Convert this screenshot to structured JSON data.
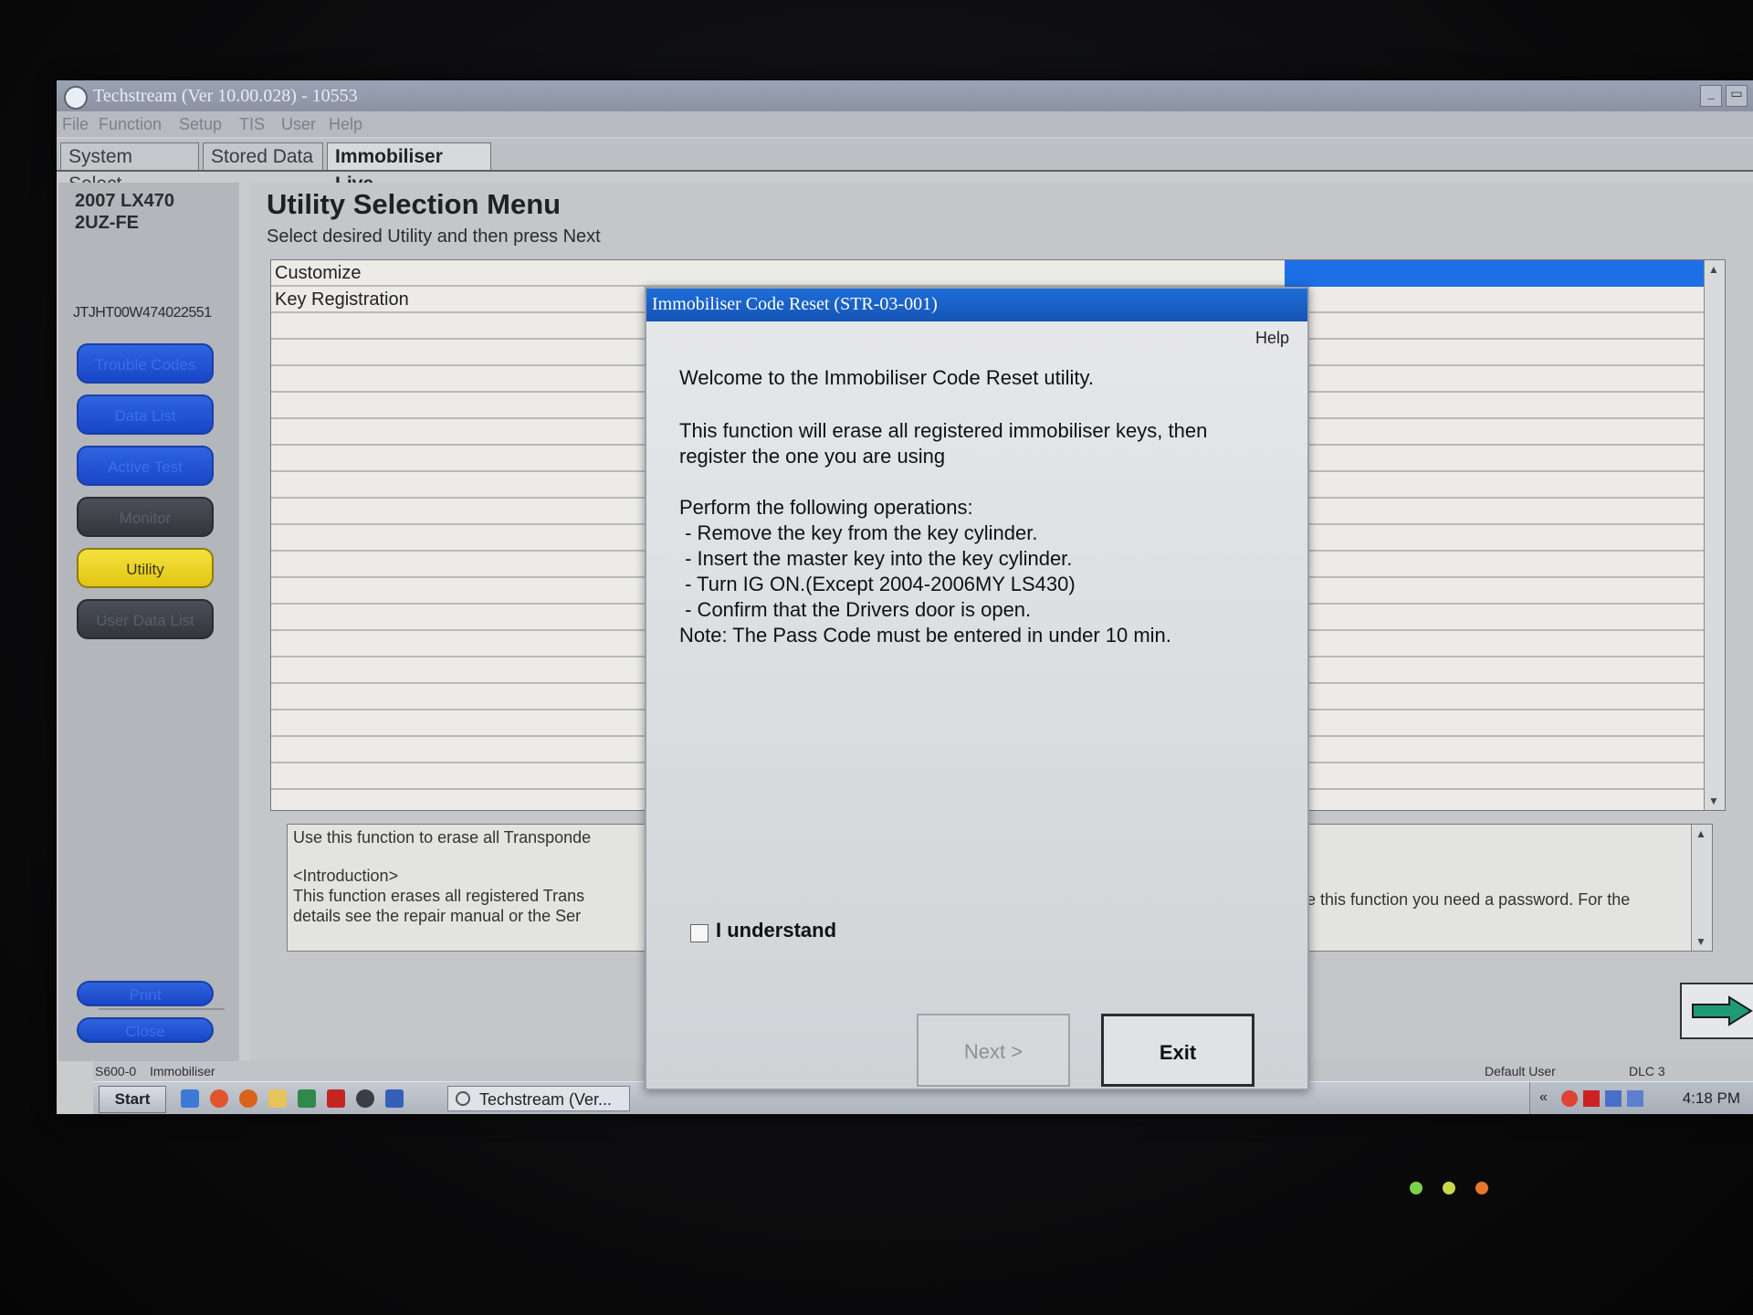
{
  "window": {
    "title": "Techstream (Ver 10.00.028) - 10553",
    "minimize_label": "_",
    "restore_label": "▭"
  },
  "menu": [
    "File",
    "Function",
    "Setup",
    "TIS",
    "User",
    "Help"
  ],
  "tabs": [
    "System Select",
    "Stored Data",
    "Immobiliser Live"
  ],
  "active_tab": "Immobiliser Live",
  "sidebar": {
    "vehicle_line1": "2007 LX470",
    "vehicle_line2": "2UZ-FE",
    "vin": "JTJHT00W474022551",
    "buttons": [
      "Trouble Codes",
      "Data List",
      "Active Test",
      "Monitor",
      "Utility",
      "User Data List"
    ],
    "active_button": "Utility",
    "print_label": "Print",
    "close_label": "Close"
  },
  "main": {
    "title": "Utility Selection Menu",
    "subtitle": "Select desired Utility and then press Next",
    "list_items": [
      "Customize",
      "Key Registration"
    ],
    "description": {
      "line1": "Use this function to erase all Transponde",
      "line2": "<Introduction>",
      "line3": "This function erases all registered Trans",
      "line4": "details see the repair manual or the Ser",
      "right_fragment": "er to use this function you need a password. For the"
    }
  },
  "status_bar": {
    "code": "S600-0",
    "system": "Immobiliser",
    "user": "Default User",
    "connector": "DLC 3"
  },
  "taskbar": {
    "start_label": "Start",
    "task_label": "Techstream (Ver...",
    "tray_chevron": "«",
    "clock": "4:18 PM"
  },
  "dialog": {
    "title": "Immobiliser Code Reset (STR-03-001)",
    "help_label": "Help",
    "welcome": "Welcome to the Immobiliser Code Reset utility.",
    "warning_line1": "This function will erase all registered immobiliser keys, then",
    "warning_line2": "register the one you are using",
    "ops_header": "Perform the following operations:",
    "op1": " - Remove the key from the key cylinder.",
    "op2": " - Insert the master key into the key cylinder.",
    "op3": " - Turn IG ON.(Except 2004-2006MY LS430)",
    "op4": " - Confirm that the Drivers door is open.",
    "note": "Note: The Pass Code must be entered in under 10 min.",
    "checkbox_label": "I understand",
    "checkbox_checked": false,
    "next_label": "Next >",
    "exit_label": "Exit"
  },
  "colors": {
    "accent_blue": "#1d6fe6",
    "utility_yellow": "#f4e23d",
    "dialog_title": "#1e6ed8"
  }
}
